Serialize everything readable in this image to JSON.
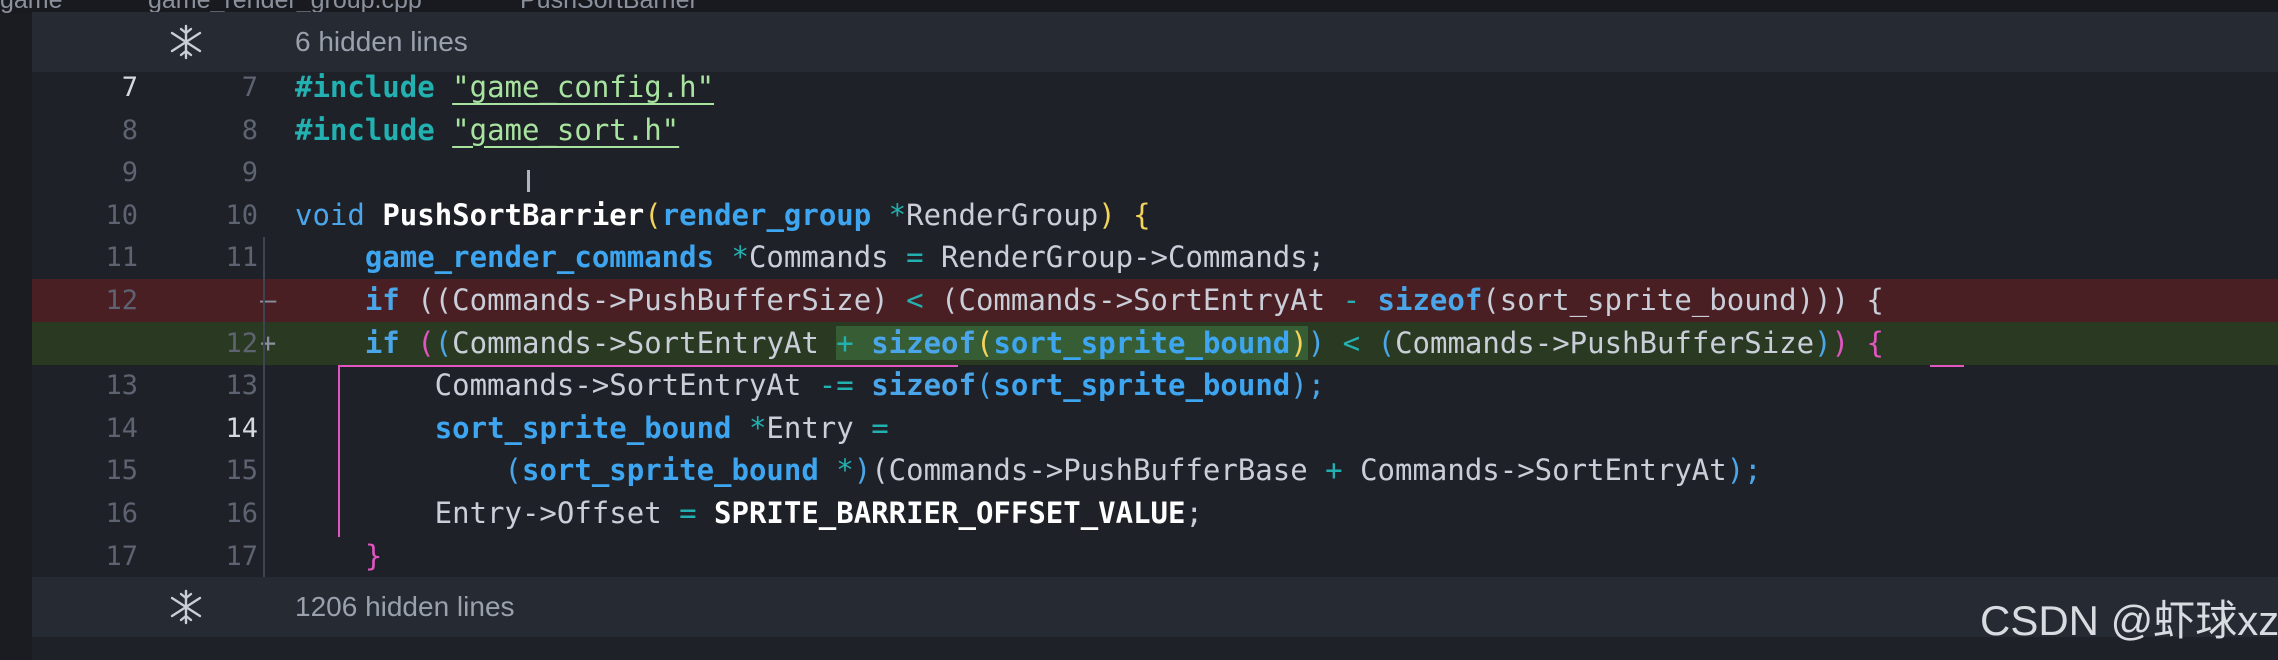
{
  "breadcrumb": {
    "segments": [
      "game",
      "game_render_group.cpp",
      "PushSortBarrier"
    ]
  },
  "fold_top": {
    "label": "6 hidden lines",
    "icon": "unfold-icon"
  },
  "fold_bottom": {
    "label": "1206 hidden lines",
    "icon": "unfold-icon"
  },
  "lines": [
    {
      "old": "7",
      "new": "7",
      "sign": "",
      "kind": "ctx",
      "tokens": [
        {
          "t": "#include",
          "c": "#22b0b0",
          "b": 1
        },
        {
          "t": " ",
          "c": "#c9ced8"
        },
        {
          "t": "\"game_config.h\"",
          "c": "#a8e3a0",
          "u": "#a8e3a0"
        }
      ]
    },
    {
      "old": "8",
      "new": "8",
      "sign": "",
      "kind": "ctx",
      "tokens": [
        {
          "t": "#include",
          "c": "#22b0b0",
          "b": 1
        },
        {
          "t": " ",
          "c": "#c9ced8"
        },
        {
          "t": "\"game_sort.h\"",
          "c": "#a8e3a0",
          "u": "#a8e3a0"
        }
      ]
    },
    {
      "old": "9",
      "new": "9",
      "sign": "",
      "kind": "ctx",
      "tokens": []
    },
    {
      "old": "10",
      "new": "10",
      "sign": "",
      "kind": "ctx",
      "tokens": [
        {
          "t": "void ",
          "c": "#4aa6e8"
        },
        {
          "t": "PushSortBarrier",
          "c": "#ffffff",
          "b": 1
        },
        {
          "t": "(",
          "c": "#f2d45c"
        },
        {
          "t": "render_group",
          "c": "#3ea6f0",
          "b": 1
        },
        {
          "t": " *",
          "c": "#22b0b0"
        },
        {
          "t": "RenderGroup",
          "c": "#c9ced8"
        },
        {
          "t": ") {",
          "c": "#f2d45c"
        }
      ]
    },
    {
      "old": "11",
      "new": "11",
      "sign": "",
      "kind": "ctx",
      "tokens": [
        {
          "t": "    ",
          "c": "#c9ced8"
        },
        {
          "t": "game_render_commands",
          "c": "#3ea6f0",
          "b": 1
        },
        {
          "t": " *",
          "c": "#22b0b0"
        },
        {
          "t": "Commands ",
          "c": "#c9ced8"
        },
        {
          "t": "=",
          "c": "#22b0b0"
        },
        {
          "t": " RenderGroup->Commands;",
          "c": "#c9ced8"
        }
      ]
    },
    {
      "old": "12",
      "new": "",
      "sign": "—",
      "kind": "del",
      "tokens": [
        {
          "t": "    ",
          "c": "#c9ced8"
        },
        {
          "t": "if",
          "c": "#4aa6e8",
          "b": 1
        },
        {
          "t": " ((Commands->PushBufferSize) ",
          "c": "#c9ced8"
        },
        {
          "t": "<",
          "c": "#22b0b0"
        },
        {
          "t": " (Commands->SortEntryAt ",
          "c": "#c9ced8"
        },
        {
          "t": "-",
          "c": "#22b0b0"
        },
        {
          "t": " ",
          "c": "#c9ced8"
        },
        {
          "t": "sizeof",
          "c": "#4aa6e8",
          "b": 1
        },
        {
          "t": "(sort_sprite_bound))) {",
          "c": "#c9ced8"
        }
      ]
    },
    {
      "old": "",
      "new": "12",
      "sign": "+",
      "kind": "ins",
      "tokens": [
        {
          "t": "    ",
          "c": "#c9ced8"
        },
        {
          "t": "if",
          "c": "#4aa6e8",
          "b": 1
        },
        {
          "t": " ",
          "c": "#c9ced8"
        },
        {
          "t": "(",
          "c": "#e055c0"
        },
        {
          "t": "(",
          "c": "#4aa6e8"
        },
        {
          "t": "Commands->SortEntryAt ",
          "c": "#c9ced8"
        },
        {
          "t": "+ ",
          "c": "#22b0b0",
          "h": 1
        },
        {
          "t": "sizeof",
          "c": "#4aa6e8",
          "b": 1,
          "h": 1
        },
        {
          "t": "(",
          "c": "#f2d45c",
          "h": 1
        },
        {
          "t": "sort_sprite_bound",
          "c": "#3ea6f0",
          "b": 1,
          "h": 1
        },
        {
          "t": ")",
          "c": "#f2d45c",
          "h": 1
        },
        {
          "t": ")",
          "c": "#4aa6e8"
        },
        {
          "t": " ",
          "c": "#c9ced8"
        },
        {
          "t": "<",
          "c": "#22b0b0"
        },
        {
          "t": " ",
          "c": "#c9ced8"
        },
        {
          "t": "(",
          "c": "#4aa6e8"
        },
        {
          "t": "Commands->PushBufferSize",
          "c": "#c9ced8"
        },
        {
          "t": ")",
          "c": "#4aa6e8"
        },
        {
          "t": ") {",
          "c": "#e055c0"
        }
      ]
    },
    {
      "old": "13",
      "new": "13",
      "sign": "",
      "kind": "ctx",
      "tokens": [
        {
          "t": "        Commands->SortEntryAt ",
          "c": "#c9ced8"
        },
        {
          "t": "-=",
          "c": "#22b0b0"
        },
        {
          "t": " ",
          "c": "#c9ced8"
        },
        {
          "t": "sizeof",
          "c": "#4aa6e8",
          "b": 1
        },
        {
          "t": "(",
          "c": "#4aa6e8"
        },
        {
          "t": "sort_sprite_bound",
          "c": "#3ea6f0",
          "b": 1
        },
        {
          "t": ");",
          "c": "#4aa6e8"
        }
      ]
    },
    {
      "old": "14",
      "new": "14",
      "sign": "",
      "kind": "ctx",
      "cur": true,
      "tokens": [
        {
          "t": "        ",
          "c": "#c9ced8"
        },
        {
          "t": "sort_sprite_bound",
          "c": "#3ea6f0",
          "b": 1
        },
        {
          "t": " *",
          "c": "#22b0b0"
        },
        {
          "t": "Entry ",
          "c": "#c9ced8"
        },
        {
          "t": "=",
          "c": "#22b0b0"
        }
      ]
    },
    {
      "old": "15",
      "new": "15",
      "sign": "",
      "kind": "ctx",
      "tokens": [
        {
          "t": "            ",
          "c": "#c9ced8"
        },
        {
          "t": "(",
          "c": "#4aa6e8"
        },
        {
          "t": "sort_sprite_bound",
          "c": "#3ea6f0",
          "b": 1
        },
        {
          "t": " *",
          "c": "#22b0b0"
        },
        {
          "t": ")",
          "c": "#4aa6e8"
        },
        {
          "t": "(Commands->PushBufferBase ",
          "c": "#c9ced8"
        },
        {
          "t": "+",
          "c": "#22b0b0"
        },
        {
          "t": " Commands->SortEntryAt",
          "c": "#c9ced8"
        },
        {
          "t": ");",
          "c": "#4aa6e8"
        }
      ]
    },
    {
      "old": "16",
      "new": "16",
      "sign": "",
      "kind": "ctx",
      "tokens": [
        {
          "t": "        Entry->Offset ",
          "c": "#c9ced8"
        },
        {
          "t": "=",
          "c": "#22b0b0"
        },
        {
          "t": " ",
          "c": "#c9ced8"
        },
        {
          "t": "SPRITE_BARRIER_OFFSET_VALUE",
          "c": "#ffffff",
          "b": 1
        },
        {
          "t": ";",
          "c": "#c9ced8"
        }
      ]
    },
    {
      "old": "17",
      "new": "17",
      "sign": "",
      "kind": "ctx",
      "tokens": [
        {
          "t": "    ",
          "c": "#c9ced8"
        },
        {
          "t": "}",
          "c": "#e055c0"
        }
      ]
    }
  ],
  "watermark": "CSDN @虾球xz"
}
